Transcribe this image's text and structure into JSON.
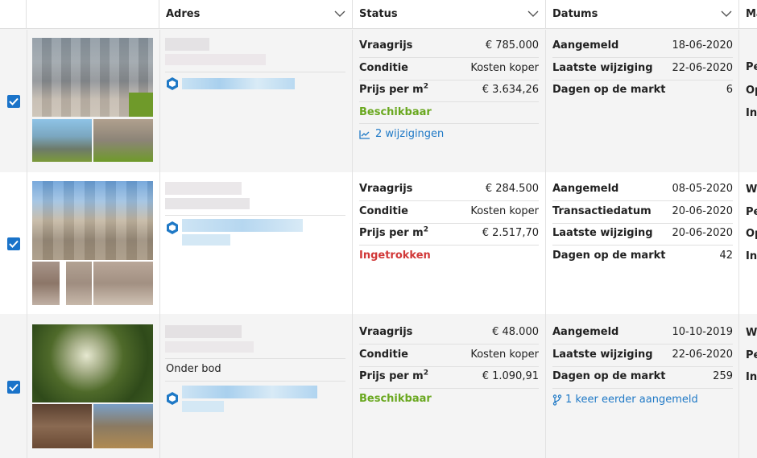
{
  "columns": {
    "adres": "Adres",
    "status": "Status",
    "datums": "Datums",
    "more": "Ma"
  },
  "rows": [
    {
      "address_extra": "",
      "status": [
        {
          "key": "Vraagrijs",
          "value": "€ 785.000"
        },
        {
          "key": "Conditie",
          "value": "Kosten koper"
        },
        {
          "key": "Prijs per m",
          "value": "€ 3.634,26"
        }
      ],
      "availability": "Beschikbaar",
      "availability_color": "#6aa820",
      "link": "2 wijzigingen",
      "link_icon": "trend-chart-icon",
      "dates": [
        {
          "key": "Aangemeld",
          "value": "18-06-2020"
        },
        {
          "key": "Laatste wijziging",
          "value": "22-06-2020"
        },
        {
          "key": "Dagen op de markt",
          "value": "6"
        }
      ],
      "cut": [
        "Pe",
        "Op",
        "Inl"
      ]
    },
    {
      "address_extra": "",
      "status": [
        {
          "key": "Vraagrijs",
          "value": "€ 284.500"
        },
        {
          "key": "Conditie",
          "value": "Kosten koper"
        },
        {
          "key": "Prijs per m",
          "value": "€ 2.517,70"
        }
      ],
      "availability": "Ingetrokken",
      "availability_color": "#d13838",
      "link": "",
      "dates": [
        {
          "key": "Aangemeld",
          "value": "08-05-2020"
        },
        {
          "key": "Transactiedatum",
          "value": "20-06-2020"
        },
        {
          "key": "Laatste wijziging",
          "value": "20-06-2020"
        },
        {
          "key": "Dagen op de markt",
          "value": "42"
        }
      ],
      "cut": [
        "We",
        "Pe",
        "Op",
        "Inl"
      ]
    },
    {
      "address_extra": "Onder bod",
      "status": [
        {
          "key": "Vraagrijs",
          "value": "€ 48.000"
        },
        {
          "key": "Conditie",
          "value": "Kosten koper"
        },
        {
          "key": "Prijs per m",
          "value": "€ 1.090,91"
        }
      ],
      "availability": "Beschikbaar",
      "availability_color": "#6aa820",
      "link": "1 keer eerder aangemeld",
      "link_icon": "branch-icon",
      "dates": [
        {
          "key": "Aangemeld",
          "value": "10-10-2019"
        },
        {
          "key": "Laatste wijziging",
          "value": "22-06-2020"
        },
        {
          "key": "Dagen op de markt",
          "value": "259"
        }
      ],
      "cut": [
        "We",
        "Pe",
        "Inl"
      ]
    }
  ],
  "squared": "2"
}
